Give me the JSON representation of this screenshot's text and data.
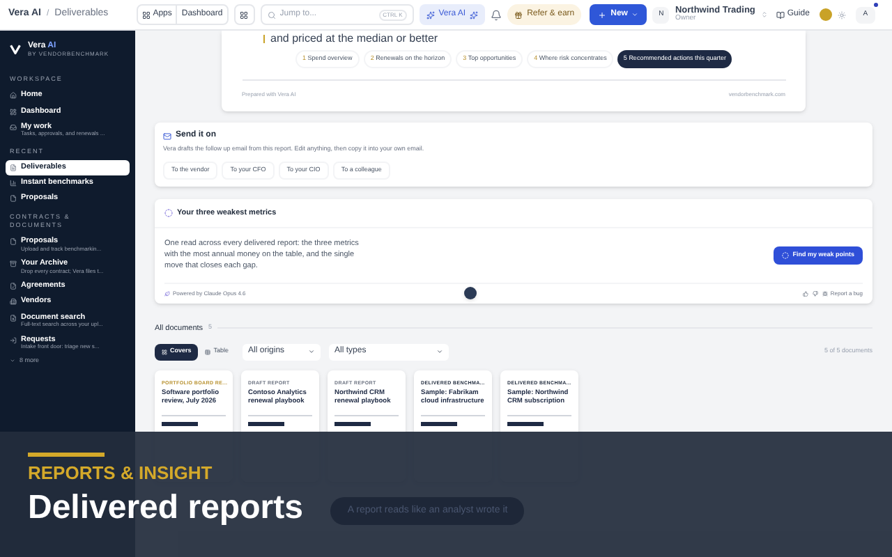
{
  "topbar": {
    "breadcrumb": [
      "Vera AI",
      "Deliverables"
    ],
    "separator": "/",
    "apps": "Apps",
    "dashboard": "Dashboard",
    "search_placeholder": "Jump to...",
    "shortcut": "CTRL K",
    "vera_button": "Vera AI",
    "refer": "Refer & earn",
    "new": "New",
    "org_initial": "N",
    "org_name": "Northwind Trading",
    "org_role": "Owner",
    "guide": "Guide",
    "avatar": "A",
    "notification_dot": true
  },
  "sidebar": {
    "brand": "Vera",
    "brand_accent": "AI",
    "brand_sub": "BY VENDORBENCHMARK",
    "sections": [
      {
        "title": "WORKSPACE",
        "items": [
          {
            "label": "Home",
            "selected": false
          },
          {
            "label": "Dashboard",
            "selected": false
          },
          {
            "label": "My work",
            "sub": "Tasks, approvals, and renewals ...",
            "selected": false
          }
        ]
      },
      {
        "title": "RECENT",
        "items": [
          {
            "label": "Deliverables",
            "selected": true
          },
          {
            "label": "Instant benchmarks",
            "selected": false
          },
          {
            "label": "Proposals",
            "selected": false
          }
        ]
      },
      {
        "title": "CONTRACTS & DOCUMENTS",
        "items": [
          {
            "label": "Proposals",
            "sub": "Upload and track benchmarkin...",
            "selected": false
          },
          {
            "label": "Your Archive",
            "sub": "Drop every contract; Vera files t...",
            "selected": false
          },
          {
            "label": "Agreements",
            "selected": false
          },
          {
            "label": "Vendors",
            "selected": false
          },
          {
            "label": "Document search",
            "sub": "Full-text search across your upl...",
            "selected": false
          },
          {
            "label": "Requests",
            "sub": "Intake front door: triage new s...",
            "selected": false
          }
        ]
      }
    ],
    "more": "8 more"
  },
  "preview": {
    "partial_line": "and priced at the median or better",
    "steps": [
      {
        "num": "1",
        "label": "Spend overview",
        "selected": false
      },
      {
        "num": "2",
        "label": "Renewals on the horizon",
        "selected": false
      },
      {
        "num": "3",
        "label": "Top opportunities",
        "selected": false
      },
      {
        "num": "4",
        "label": "Where risk concentrates",
        "selected": false
      },
      {
        "num": "5",
        "label": "Recommended actions this quarter",
        "selected": true
      }
    ],
    "footer_left": "Prepared with Vera AI",
    "footer_right": "vendorbenchmark.com"
  },
  "send_card": {
    "title": "Send it on",
    "text": "Vera drafts the follow up email from this report. Edit anything, then copy it into your own email.",
    "options": [
      "To the vendor",
      "To your CFO",
      "To your CIO",
      "To a colleague"
    ]
  },
  "weak_card": {
    "title": "Your three weakest metrics",
    "text": "One read across every delivered report: the three metrics with the most annual money on the table, and the single move that closes each gap.",
    "button": "Find my weak points",
    "powered": "Powered by Claude Opus 4.6",
    "report_bug": "Report a bug"
  },
  "documents": {
    "title": "All documents",
    "count": "5",
    "views": [
      {
        "label": "Covers",
        "selected": true
      },
      {
        "label": "Table",
        "selected": false
      }
    ],
    "filters": [
      "All origins",
      "All types"
    ],
    "summary": "5 of 5 documents",
    "cards": [
      {
        "tag": "PORTFOLIO BOARD RE...",
        "title": "Software portfolio review, July 2026",
        "color": "#b8912f"
      },
      {
        "tag": "DRAFT REPORT",
        "title": "Contoso Analytics renewal playbook",
        "color": "#6b7280"
      },
      {
        "tag": "DRAFT REPORT",
        "title": "Northwind CRM renewal playbook",
        "color": "#6b7280"
      },
      {
        "tag": "DELIVERED BENCHMA...",
        "title": "Sample: Fabrikam cloud infrastructure",
        "color": "#1e293b"
      },
      {
        "tag": "DELIVERED BENCHMA...",
        "title": "Sample: Northwind CRM subscription",
        "color": "#1e293b"
      }
    ]
  },
  "overlay": {
    "kicker": "REPORTS & INSIGHT",
    "title": "Delivered reports",
    "pill": "A report reads like an analyst wrote it"
  }
}
